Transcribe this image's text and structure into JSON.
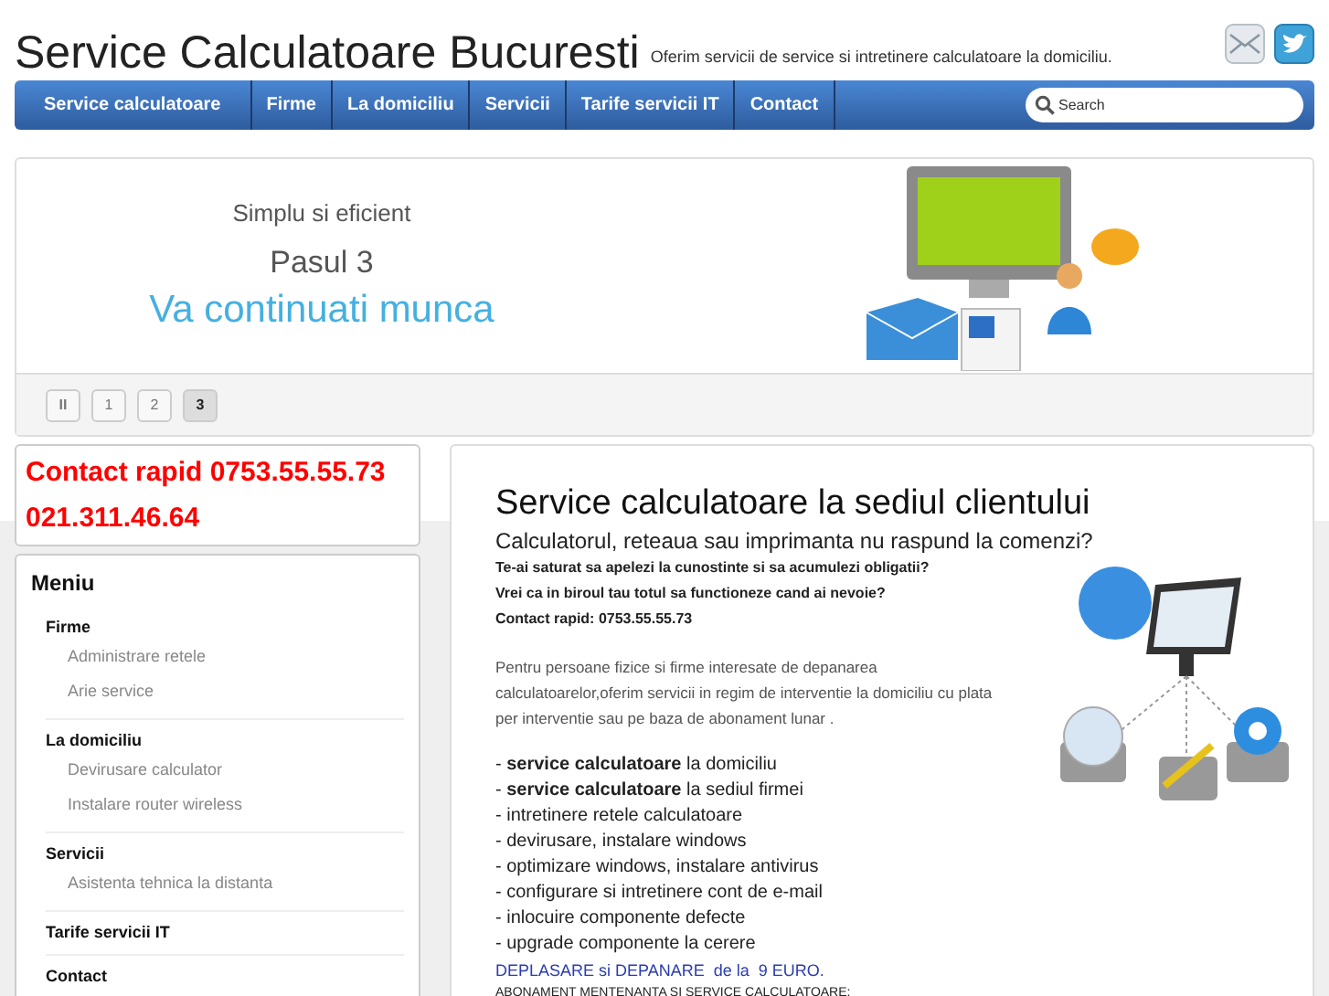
{
  "header": {
    "title": "Service Calculatoare Bucuresti",
    "tagline": "Oferim servicii de service si intretinere calculatoare la domiciliu."
  },
  "nav": {
    "items": [
      {
        "label": "Service calculatoare",
        "selected": false
      },
      {
        "label": "Firme",
        "selected": false
      },
      {
        "label": "La domiciliu",
        "selected": false
      },
      {
        "label": "Servicii",
        "selected": false
      },
      {
        "label": "Tarife servicii IT",
        "selected": false
      },
      {
        "label": "Contact",
        "selected": false
      }
    ],
    "search": {
      "placeholder": "Search"
    }
  },
  "slider": {
    "subtitle": "Simplu si eficient",
    "step": "Pasul 3",
    "headline": "Va continuati munca",
    "pages": [
      {
        "kind": "pause",
        "label": "II",
        "selected": false
      },
      {
        "kind": "page",
        "label": "1",
        "selected": false
      },
      {
        "kind": "page",
        "label": "2",
        "selected": false
      },
      {
        "kind": "page",
        "label": "3",
        "selected": true
      }
    ]
  },
  "contact_box": {
    "lines": [
      "Contact rapid 0753.55.55.73",
      "021.311.46.64"
    ]
  },
  "menu": {
    "title": "Meniu",
    "groups": [
      {
        "label": "Firme",
        "children": [
          {
            "label": "Administrare retele"
          },
          {
            "label": "Arie service"
          }
        ]
      },
      {
        "label": "La domiciliu",
        "children": [
          {
            "label": "Devirusare calculator"
          },
          {
            "label": "Instalare router wireless"
          }
        ]
      },
      {
        "label": "Servicii",
        "children": [
          {
            "label": "Asistenta tehnica la distanta"
          }
        ]
      },
      {
        "label": "Tarife servicii IT"
      },
      {
        "label": "Contact"
      }
    ]
  },
  "article": {
    "title": "Service calculatoare la sediul clientului",
    "subtitle": "Calculatorul, reteaua sau imprimanta nu raspund la comenzi?",
    "bold_lines": [
      "Te-ai saturat sa apelezi la cunostinte si sa acumulezi obligatii?",
      "Vrei ca in biroul tau totul sa functioneze cand ai nevoie?",
      "Contact rapid: 0753.55.55.73"
    ],
    "paragraph": "Pentru persoane fizice si firme interesate de depanarea calculatoarelor,oferim servicii in regim de interventie la domiciliu cu plata per interventie sau pe baza de abonament lunar .",
    "list": [
      "- **service calculatoare** la domiciliu",
      "- **service calculatoare** la sediul firmei",
      "- intretinere retele calculatoare",
      "- devirusare, instalare windows",
      "- optimizare windows, instalare antivirus",
      "- configurare si intretinere cont de e-mail",
      "- inlocuire componente defecte",
      "- upgrade componente la cerere"
    ],
    "offer": "DEPLASARE si DEPANARE  de la  9 EURO.",
    "cut_line": "ABONAMENT MENTENANTA SI SERVICE CALCULATOARE:"
  }
}
